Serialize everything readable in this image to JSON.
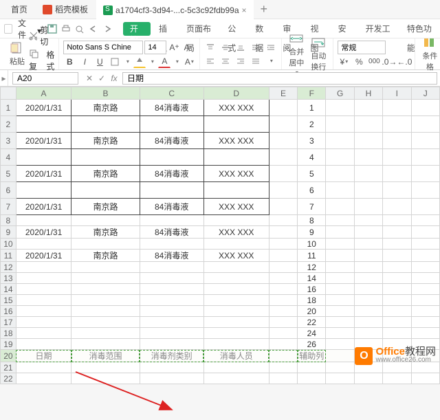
{
  "tabs": {
    "home": "首页",
    "template": "稻壳模板",
    "file": "a1704cf3-3d94-...c-5c3c92fdb99a ",
    "close": "×",
    "plus": "+"
  },
  "menu": {
    "file": "文件",
    "drop": "▾"
  },
  "ribbon_tabs": [
    "开始",
    "插入",
    "页面布局",
    "公式",
    "数据",
    "审阅",
    "视图",
    "安全",
    "开发工具",
    "特色功能"
  ],
  "ribbon": {
    "paste": "粘贴",
    "cut": "剪切",
    "copy": "复制",
    "format_painter": "格式刷",
    "font_name": "Noto Sans S Chine",
    "font_size": "14",
    "merge": "合并居中",
    "wrap": "自动换行",
    "number_format": "常规",
    "cond_fmt": "条件格"
  },
  "namebox": "A20",
  "fx_label": "fx",
  "formula": "日期",
  "cols": [
    "A",
    "B",
    "C",
    "D",
    "E",
    "F",
    "G",
    "H",
    "I",
    "J"
  ],
  "rows_idx": [
    1,
    2,
    3,
    4,
    5,
    6,
    7,
    8,
    9,
    10,
    11,
    12,
    13,
    14,
    15,
    16,
    17,
    18,
    19,
    20,
    21,
    22
  ],
  "data": {
    "r1": {
      "a": "2020/1/31",
      "b": "南京路",
      "c": "84消毒液",
      "d": "XXX XXX",
      "f": "1"
    },
    "r2": {
      "f": "2"
    },
    "r3": {
      "a": "2020/1/31",
      "b": "南京路",
      "c": "84消毒液",
      "d": "XXX XXX",
      "f": "3"
    },
    "r4": {
      "f": "4"
    },
    "r5": {
      "a": "2020/1/31",
      "b": "南京路",
      "c": "84消毒液",
      "d": "XXX XXX",
      "f": "5"
    },
    "r6": {
      "f": "6"
    },
    "r7": {
      "a": "2020/1/31",
      "b": "南京路",
      "c": "84消毒液",
      "d": "XXX XXX",
      "f": "7"
    },
    "r8": {
      "f": "8"
    },
    "r9": {
      "a": "2020/1/31",
      "b": "南京路",
      "c": "84消毒液",
      "d": "XXX XXX",
      "f": "9"
    },
    "r10": {
      "f": "10"
    },
    "r11": {
      "a": "2020/1/31",
      "b": "南京路",
      "c": "84消毒液",
      "d": "XXX XXX",
      "f": "11"
    },
    "r12": {
      "f": "12"
    },
    "r13": {
      "f": "14"
    },
    "r14": {
      "f": "16"
    },
    "r15": {
      "f": "18"
    },
    "r16": {
      "f": "20"
    },
    "r17": {
      "f": "22"
    },
    "r18": {
      "f": "24"
    },
    "r19": {
      "f": "26"
    },
    "r20": {
      "a": "日期",
      "b": "消毒范围",
      "c": "消毒剂类别",
      "d": "消毒人员",
      "f": "辅助列"
    }
  },
  "watermark": {
    "brand": "Office",
    "suffix": "教程网",
    "url": "www.office26.com",
    "logo": "O"
  }
}
